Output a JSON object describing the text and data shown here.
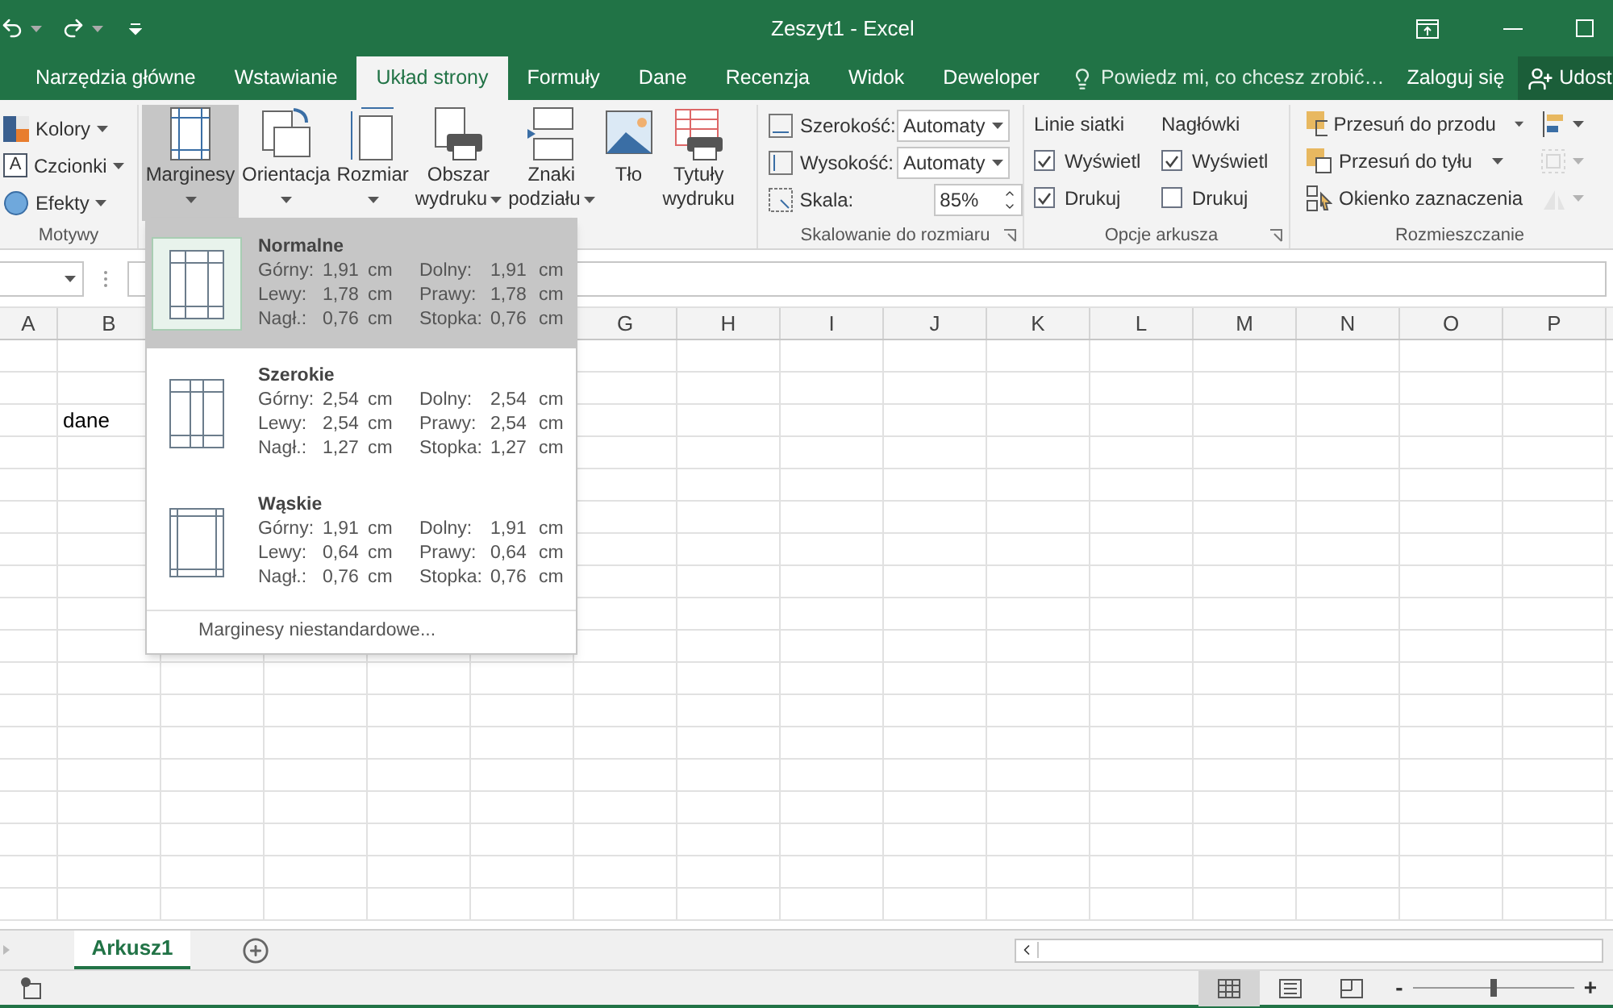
{
  "title_bar": {
    "title": "Zeszyt1 - Excel"
  },
  "tabs": [
    {
      "label": "Narzędzia główne",
      "selected": false
    },
    {
      "label": "Wstawianie",
      "selected": false
    },
    {
      "label": "Układ strony",
      "selected": true
    },
    {
      "label": "Formuły",
      "selected": false
    },
    {
      "label": "Dane",
      "selected": false
    },
    {
      "label": "Recenzja",
      "selected": false
    },
    {
      "label": "Widok",
      "selected": false
    },
    {
      "label": "Deweloper",
      "selected": false
    }
  ],
  "tell_me": "Powiedz mi, co chcesz zrobić…",
  "sign_in": "Zaloguj się",
  "share": "Udost",
  "themes": {
    "label": "Motywy",
    "items": [
      {
        "kind": "colors",
        "label": "Kolory"
      },
      {
        "kind": "fonts",
        "label": "Czcionki",
        "icon_letter": "A"
      },
      {
        "kind": "effects",
        "label": "Efekty"
      }
    ]
  },
  "page_setup": [
    {
      "kind": "margins",
      "lines": [
        "Marginesy"
      ],
      "menu": true,
      "selected": true
    },
    {
      "kind": "orientation",
      "lines": [
        "Orientacja"
      ],
      "menu": true,
      "selected": false
    },
    {
      "kind": "size",
      "lines": [
        "Rozmiar"
      ],
      "menu": true,
      "selected": false
    },
    {
      "kind": "print_area",
      "lines": [
        "Obszar",
        "wydruku"
      ],
      "menu": true,
      "selected": false
    },
    {
      "kind": "breaks",
      "lines": [
        "Znaki",
        "podziału"
      ],
      "menu": true,
      "selected": false
    },
    {
      "kind": "background",
      "lines": [
        "Tło"
      ],
      "menu": false,
      "selected": false
    },
    {
      "kind": "print_titles",
      "lines": [
        "Tytuły",
        "wydruku"
      ],
      "menu": false,
      "selected": false
    }
  ],
  "scale": {
    "label": "Skalowanie do rozmiaru",
    "width": {
      "label": "Szerokość:",
      "value": "Automaty"
    },
    "height": {
      "label": "Wysokość:",
      "value": "Automaty"
    },
    "scale": {
      "label": "Skala:",
      "value": "85%"
    }
  },
  "sheet_options": {
    "label": "Opcje arkusza",
    "columns": [
      {
        "heading": "Linie siatki",
        "options": [
          {
            "label": "Wyświetl",
            "checked": true
          },
          {
            "label": "Drukuj",
            "checked": true
          }
        ]
      },
      {
        "heading": "Nagłówki",
        "options": [
          {
            "label": "Wyświetl",
            "checked": true
          },
          {
            "label": "Drukuj",
            "checked": false
          }
        ]
      }
    ]
  },
  "arrange": {
    "label": "Rozmieszczanie",
    "items": [
      {
        "kind": "forward",
        "label": "Przesuń do przodu",
        "menu": true
      },
      {
        "kind": "backward",
        "label": "Przesuń do tyłu",
        "menu": true
      },
      {
        "kind": "selection",
        "label": "Okienko zaznaczenia",
        "menu": false
      }
    ],
    "side_tools": [
      {
        "kind": "align",
        "disabled": false
      },
      {
        "kind": "group",
        "disabled": true
      },
      {
        "kind": "rotate",
        "disabled": true
      }
    ]
  },
  "columns_left": [
    "A",
    "B"
  ],
  "columns_right": [
    "G",
    "H",
    "I",
    "J",
    "K",
    "L",
    "M",
    "N",
    "O",
    "P"
  ],
  "cells": [
    {
      "text": "dane"
    }
  ],
  "margins_menu": {
    "items": [
      {
        "kind": "normal",
        "name": "Normalne",
        "selected": true,
        "rows": [
          [
            "Górny:",
            "1,91",
            "cm",
            "Dolny:",
            "1,91",
            "cm"
          ],
          [
            "Lewy:",
            "1,78",
            "cm",
            "Prawy:",
            "1,78",
            "cm"
          ],
          [
            "Nagł.:",
            "0,76",
            "cm",
            "Stopka:",
            "0,76",
            "cm"
          ]
        ]
      },
      {
        "kind": "wide",
        "name": "Szerokie",
        "selected": false,
        "rows": [
          [
            "Górny:",
            "2,54",
            "cm",
            "Dolny:",
            "2,54",
            "cm"
          ],
          [
            "Lewy:",
            "2,54",
            "cm",
            "Prawy:",
            "2,54",
            "cm"
          ],
          [
            "Nagł.:",
            "1,27",
            "cm",
            "Stopka:",
            "1,27",
            "cm"
          ]
        ]
      },
      {
        "kind": "narrow",
        "name": "Wąskie",
        "selected": false,
        "rows": [
          [
            "Górny:",
            "1,91",
            "cm",
            "Dolny:",
            "1,91",
            "cm"
          ],
          [
            "Lewy:",
            "0,64",
            "cm",
            "Prawy:",
            "0,64",
            "cm"
          ],
          [
            "Nagł.:",
            "0,76",
            "cm",
            "Stopka:",
            "0,76",
            "cm"
          ]
        ]
      }
    ],
    "custom": "Marginesy niestandardowe..."
  },
  "sheet_tabs": [
    {
      "label": "Arkusz1",
      "selected": true
    }
  ],
  "status_bar": {
    "views": [
      {
        "kind": "normal",
        "selected": true
      },
      {
        "kind": "page_layout",
        "selected": false
      },
      {
        "kind": "page_break",
        "selected": false
      }
    ],
    "zoom": {
      "minus": "-",
      "plus": "+",
      "level": 0.5
    }
  }
}
